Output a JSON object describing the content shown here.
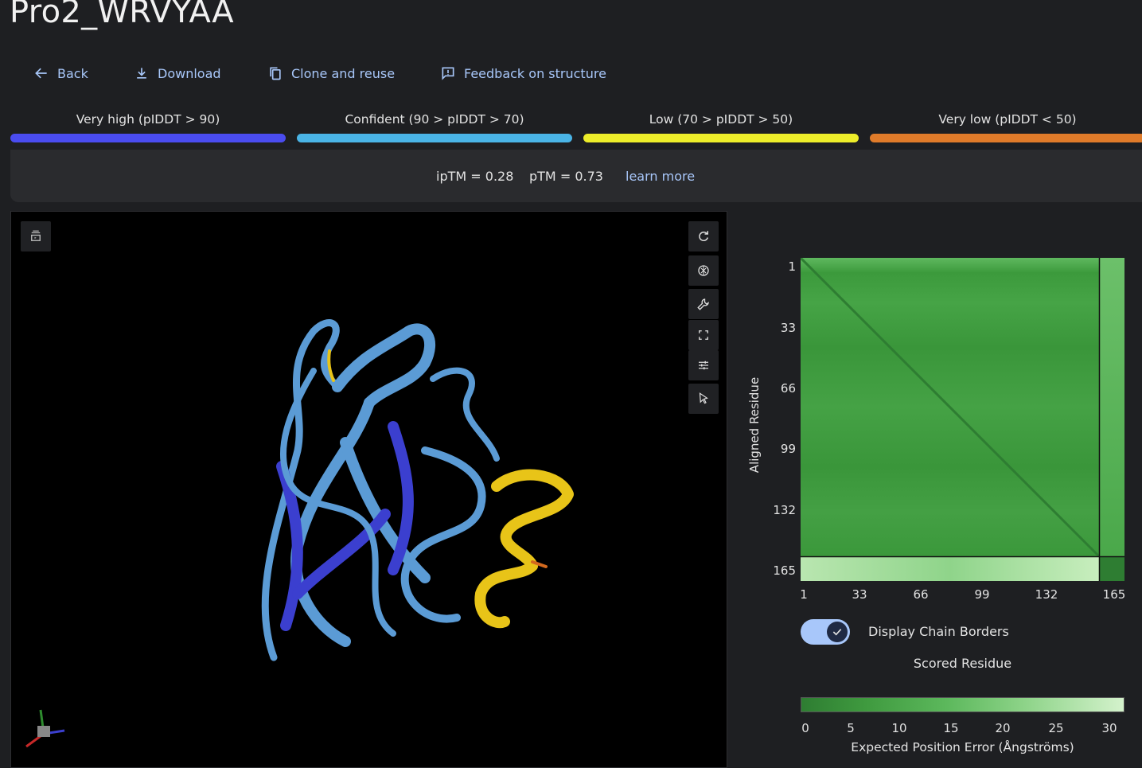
{
  "page_title": "Pro2_WRVYAA",
  "actions": {
    "back": "Back",
    "download": "Download",
    "clone": "Clone and reuse",
    "feedback": "Feedback on structure"
  },
  "legend": [
    {
      "label": "Very high (pIDDT > 90)",
      "color": "#4a4cf0"
    },
    {
      "label": "Confident (90 > pIDDT > 70)",
      "color": "#4ab4e6"
    },
    {
      "label": "Low (70 > pIDDT > 50)",
      "color": "#eded2a"
    },
    {
      "label": "Very low (pIDDT < 50)",
      "color": "#e07b2a"
    }
  ],
  "scores": {
    "iptm": "ipTM = 0.28",
    "ptm": "pTM = 0.73",
    "learn_more": "learn more"
  },
  "viewer": {
    "tools": [
      "layers-icon",
      "rotate-icon",
      "focus-icon",
      "wrench-icon",
      "fullscreen-icon",
      "sliders-icon",
      "pointer-icon"
    ]
  },
  "pae": {
    "y_axis_label": "Aligned Residue",
    "y_ticks": [
      "1",
      "33",
      "66",
      "99",
      "132",
      "165"
    ],
    "x_ticks": [
      "1",
      "33",
      "66",
      "99",
      "132",
      "165"
    ],
    "toggle_label": "Display Chain Borders",
    "toggle_on": true,
    "x_axis_label": "Scored Residue",
    "colorbar_ticks": [
      "0",
      "5",
      "10",
      "15",
      "20",
      "25",
      "30"
    ],
    "colorbar_label": "Expected Position Error (Ångströms)",
    "colors": {
      "low_error": "#2e7d32",
      "high_error": "#d4f2cc"
    }
  }
}
